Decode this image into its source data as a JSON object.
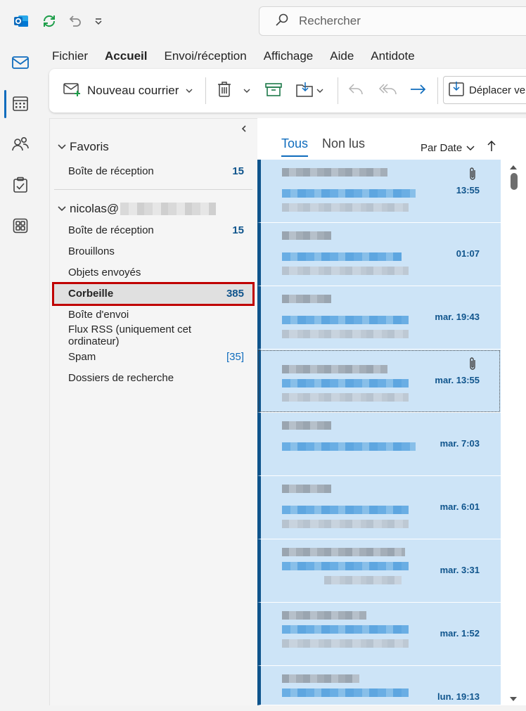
{
  "search": {
    "placeholder": "Rechercher"
  },
  "menu": {
    "tabs": [
      {
        "label": "Fichier"
      },
      {
        "label": "Accueil",
        "active": true
      },
      {
        "label": "Envoi/réception"
      },
      {
        "label": "Affichage"
      },
      {
        "label": "Aide"
      },
      {
        "label": "Antidote"
      }
    ]
  },
  "ribbon": {
    "new_mail": "Nouveau courrier",
    "move_to": "Déplacer vers"
  },
  "folders": {
    "favorites": {
      "title": "Favoris",
      "items": [
        {
          "label": "Boîte de réception",
          "count": "15"
        }
      ]
    },
    "account": {
      "title": "nicolas@",
      "items": [
        {
          "label": "Boîte de réception",
          "count": "15"
        },
        {
          "label": "Brouillons",
          "count": ""
        },
        {
          "label": "Objets envoyés",
          "count": ""
        },
        {
          "label": "Corbeille",
          "count": "385",
          "selected": true
        },
        {
          "label": "Boîte d'envoi",
          "count": ""
        },
        {
          "label": "Flux RSS (uniquement cet ordinateur)",
          "count": ""
        },
        {
          "label": "Spam",
          "count": "[35]"
        },
        {
          "label": "Dossiers de recherche",
          "count": ""
        }
      ]
    }
  },
  "message_list": {
    "filter_all": "Tous",
    "filter_unread": "Non lus",
    "sort_label": "Par Date",
    "messages": [
      {
        "time": "13:55",
        "attachment": true
      },
      {
        "time": "01:07",
        "attachment": false
      },
      {
        "time": "mar. 19:43",
        "attachment": false
      },
      {
        "time": "mar. 13:55",
        "attachment": true
      },
      {
        "time": "mar. 7:03",
        "attachment": false
      },
      {
        "time": "mar. 6:01",
        "attachment": false
      },
      {
        "time": "mar. 3:31",
        "attachment": false
      },
      {
        "time": "mar. 1:52",
        "attachment": false
      },
      {
        "time": "lun. 19:13",
        "attachment": false
      }
    ]
  },
  "colors": {
    "accent": "#0f6cbd",
    "selected_item_bg": "#cde4f7",
    "highlight_box": "#c00000"
  }
}
